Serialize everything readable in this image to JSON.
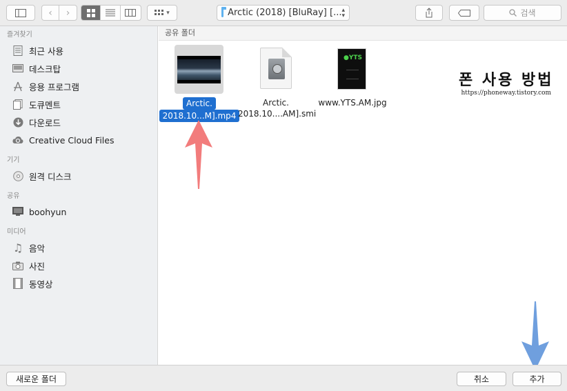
{
  "toolbar": {
    "path_label": "Arctic (2018) [BluRay] [...",
    "search_placeholder": "검색"
  },
  "sidebar": {
    "sections": [
      {
        "heading": "즐겨찾기",
        "items": [
          {
            "label": "최근 사용",
            "icon": "recents-icon"
          },
          {
            "label": "데스크탑",
            "icon": "desktop-icon"
          },
          {
            "label": "응용 프로그램",
            "icon": "applications-icon"
          },
          {
            "label": "도큐멘트",
            "icon": "documents-icon"
          },
          {
            "label": "다운로드",
            "icon": "downloads-icon"
          },
          {
            "label": "Creative Cloud Files",
            "icon": "creative-cloud-icon"
          }
        ]
      },
      {
        "heading": "기기",
        "items": [
          {
            "label": "원격 디스크",
            "icon": "remote-disc-icon"
          }
        ]
      },
      {
        "heading": "공유",
        "items": [
          {
            "label": "boohyun",
            "icon": "computer-icon"
          }
        ]
      },
      {
        "heading": "미디어",
        "items": [
          {
            "label": "음악",
            "icon": "music-icon"
          },
          {
            "label": "사진",
            "icon": "camera-icon"
          },
          {
            "label": "동영상",
            "icon": "movies-icon"
          }
        ]
      }
    ]
  },
  "main": {
    "header": "공유 폴더",
    "files": [
      {
        "line1": "Arctic.",
        "line2": "2018.10...M].mp4",
        "selected": true
      },
      {
        "line1": "Arctic.",
        "line2": "2018.10....AM].smi",
        "selected": false
      },
      {
        "line1": "www.YTS.AM.jpg",
        "line2": "",
        "selected": false
      }
    ]
  },
  "watermark": {
    "title": "폰 사용 방법",
    "url": "https://phoneway.tistory.com"
  },
  "bottom": {
    "new_folder": "새로운 폴더",
    "cancel": "취소",
    "add": "추가"
  },
  "colors": {
    "selection": "#1f6fd0",
    "arrow_red": "#f27c7c",
    "arrow_blue": "#6f9fde",
    "folder": "#5fb2ef"
  }
}
